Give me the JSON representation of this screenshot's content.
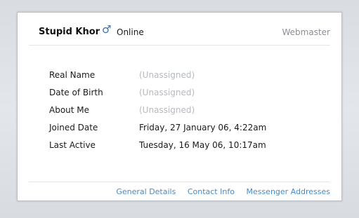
{
  "profile": {
    "name": "Stupid Khor",
    "gender_icon": "male-gender-icon",
    "gender_glyph": "♂",
    "status": "Online",
    "role": "Webmaster"
  },
  "details": [
    {
      "label": "Real Name",
      "value": "(Unassigned)",
      "unassigned": true
    },
    {
      "label": "Date of Birth",
      "value": "(Unassigned)",
      "unassigned": true
    },
    {
      "label": "About Me",
      "value": "(Unassigned)",
      "unassigned": true
    },
    {
      "label": "Joined Date",
      "value": "Friday, 27 January 06, 4:22am",
      "unassigned": false
    },
    {
      "label": "Last Active",
      "value": "Tuesday, 16 May 06, 10:17am",
      "unassigned": false
    }
  ],
  "footer": {
    "links": [
      {
        "label": "General Details"
      },
      {
        "label": "Contact Info"
      },
      {
        "label": "Messenger Addresses"
      }
    ]
  },
  "colors": {
    "link": "#4a8ac4",
    "unassigned": "#b5bac1",
    "role": "#8a8f96",
    "gender_icon": "#3a6fb2"
  }
}
